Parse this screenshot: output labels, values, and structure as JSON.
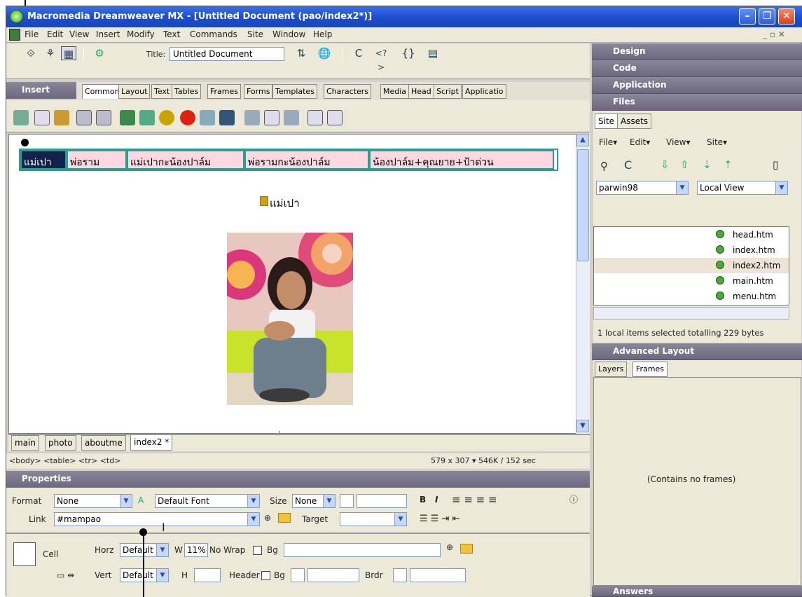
{
  "window": {
    "title": "Macromedia Dreamweaver MX - [Untitled Document (pao/index2*)]"
  },
  "menu": [
    "File",
    "Edit",
    "View",
    "Insert",
    "Modify",
    "Text",
    "Commands",
    "Site",
    "Window",
    "Help"
  ],
  "toolbar": {
    "title_label": "Title:",
    "title_value": "Untitled Document"
  },
  "insert": {
    "label": "Insert",
    "tabs": [
      "Common",
      "Layout",
      "Text",
      "Tables",
      "Frames",
      "Forms",
      "Templates",
      "Characters",
      "Media",
      "Head",
      "Script",
      "Applicatio"
    ]
  },
  "document": {
    "nav_cells": [
      "แม่เปา",
      "พ่อราม",
      "แม่เปากะน้องปาล์ม",
      "พ่อรามกะน้องปาล์ม",
      "น้องปาล์ม+คุณยาย+ป้าด่วน"
    ],
    "heading1": "แม่เปา",
    "heading2": "พ่อราม",
    "tabs": [
      "main",
      "photo",
      "aboutme",
      "index2 *"
    ]
  },
  "status": {
    "tag_selector": "<body> <table> <tr> <td>",
    "info": "579 x 307 ▾ 546K / 152 sec"
  },
  "properties": {
    "header": "Properties",
    "format_label": "Format",
    "format_value": "None",
    "font_value": "Default Font",
    "size_label": "Size",
    "size_value": "None",
    "link_label": "Link",
    "link_value": "#mampao",
    "target_label": "Target",
    "cell_label": "Cell",
    "horz_label": "Horz",
    "horz_value": "Default",
    "vert_label": "Vert",
    "vert_value": "Default",
    "w_label": "W",
    "w_value": "11%",
    "nowrap_label": "No Wrap",
    "bg_label": "Bg",
    "h_label": "H",
    "header_label": "Header",
    "brdr_label": "Brdr"
  },
  "right_panel": {
    "design": "Design",
    "code": "Code",
    "application": "Application",
    "files": "Files",
    "file_tabs": [
      "Site",
      "Assets"
    ],
    "file_menu": [
      "File▾",
      "Edit▾",
      "View▾",
      "Site▾"
    ],
    "site_value": "parwin98",
    "view_value": "Local View",
    "tree": [
      "head.htm",
      "index.htm",
      "index2.htm",
      "main.htm",
      "menu.htm"
    ],
    "selection_info": "1 local items selected totalling 229 bytes",
    "advanced": "Advanced Layout",
    "adv_tabs": [
      "Layers",
      "Frames"
    ],
    "no_frames": "(Contains no frames)",
    "answers": "Answers"
  },
  "colors": {
    "title_blue": "#2453d6",
    "nav_pink": "#fdd8e0",
    "nav_border": "#2a9d8f",
    "selected_cell": "#12224a"
  }
}
